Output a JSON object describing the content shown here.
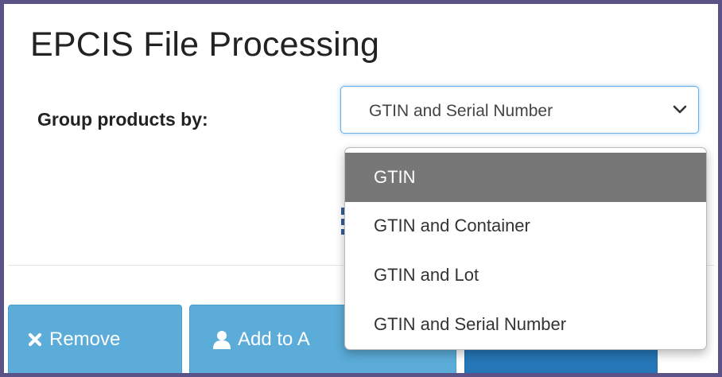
{
  "page": {
    "title": "EPCIS File Processing"
  },
  "form": {
    "group_label": "Group products by:",
    "select": {
      "value": "GTIN and Serial Number",
      "icon": "chevron-down-icon",
      "options": [
        "GTIN",
        "GTIN and Container",
        "GTIN and Lot",
        "GTIN and Serial Number"
      ],
      "highlighted_index": 0
    }
  },
  "actions": {
    "remove_label": "Remove",
    "remove_icon": "times-icon",
    "add_label": "Add to A",
    "add_icon": "user-icon",
    "third_label": ""
  },
  "colors": {
    "frame_border": "#5b5287",
    "button_light": "#5bacd9",
    "button_dark": "#2677b8",
    "option_highlight": "#777777",
    "focus_border": "#66afe9"
  }
}
